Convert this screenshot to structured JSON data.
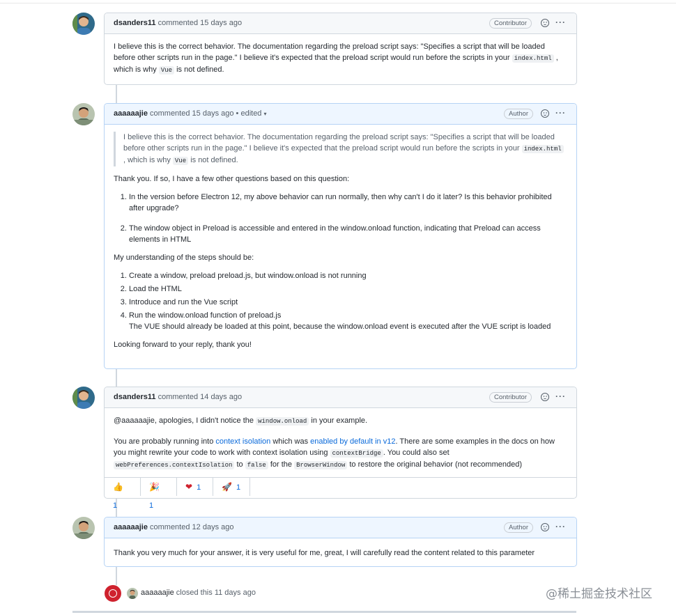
{
  "comments": [
    {
      "author": "dsanders11",
      "action": "commented",
      "time": "15 days ago",
      "edited": "",
      "badge": "Contributor",
      "body": {
        "p1a": "I believe this is the correct behavior. The documentation regarding the preload script says: \"Specifies a script that will be loaded before other scripts run in the page.\" I believe it's expected that the preload script would run before the scripts in your",
        "code1": "index.html",
        "p1b": ", which is why",
        "code2": "Vue",
        "p1c": "is not defined."
      }
    },
    {
      "author": "aaaaaajie",
      "action": "commented",
      "time": "15 days ago",
      "edited": "• edited",
      "badge": "Author",
      "body": {
        "quote_a": "I believe this is the correct behavior. The documentation regarding the preload script says: \"Specifies a script that will be loaded before other scripts run in the page.\" I believe it's expected that the preload script would run before the scripts in your",
        "quote_code1": "index.html",
        "quote_b": ", which is why",
        "quote_code2": "Vue",
        "quote_c": "is not defined.",
        "intro": "Thank you. If so, I have a few other questions based on this question:",
        "questions": [
          "In the version before Electron 12, my above behavior can run normally, then why can't I do it later? Is this behavior prohibited after upgrade?",
          "The window object in Preload is accessible and entered in the window.onload function, indicating that Preload can access elements in HTML"
        ],
        "steps_intro": "My understanding of the steps should be:",
        "steps": [
          "Create a window, preload preload.js, but window.onload is not running",
          "Load the HTML",
          "Introduce and run the Vue script",
          "Run the window.onload function of preload.js"
        ],
        "step4_note": "The VUE should already be loaded at this point, because the window.onload event is executed after the VUE script is loaded",
        "closing": "Looking forward to your reply, thank you!"
      }
    },
    {
      "author": "dsanders11",
      "action": "commented",
      "time": "14 days ago",
      "edited": "",
      "badge": "Contributor",
      "body": {
        "p1a": "@aaaaaajie, apologies, I didn't notice the",
        "code1": "window.onload",
        "p1b": "in your example.",
        "p2a": "You are probably running into",
        "link1": "context isolation",
        "p2b": "which was",
        "link2": "enabled by default in v12",
        "p2c": ". There are some examples in the docs on how you might rewrite your code to work with context isolation using",
        "code2": "contextBridge",
        "p2d": ". You could also set",
        "code3": "webPreferences.contextIsolation",
        "p2e": "to",
        "code4": "false",
        "p2f": "for the",
        "code5": "BrowserWindow",
        "p2g": "to restore the original behavior (not recommended)"
      },
      "reactions": [
        {
          "emoji": "👍",
          "count": "1"
        },
        {
          "emoji": "🎉",
          "count": "1"
        },
        {
          "emoji": "❤",
          "count": "1"
        },
        {
          "emoji": "🚀",
          "count": "1"
        }
      ]
    },
    {
      "author": "aaaaaajie",
      "action": "commented",
      "time": "12 days ago",
      "edited": "",
      "badge": "Author",
      "body": {
        "p1": "Thank you very much for your answer, it is very useful for me, great, I will carefully read the content related to this parameter"
      }
    }
  ],
  "event": {
    "actor": "aaaaaajie",
    "action": "closed this",
    "time": "11 days ago"
  },
  "watermark": "@稀土掘金技术社区",
  "colors": {
    "link": "#0969da",
    "closed": "#cf222e",
    "author_border": "#b6d3f5"
  }
}
